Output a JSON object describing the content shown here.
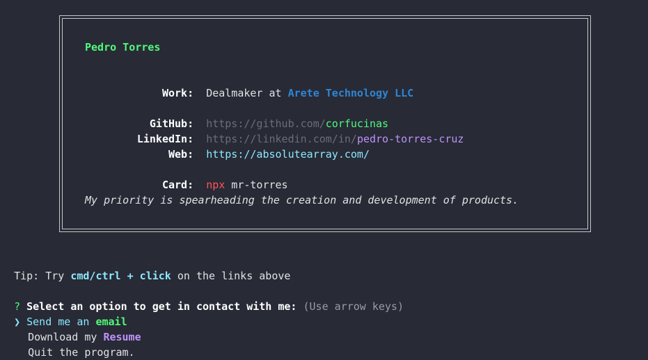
{
  "card": {
    "name": "Pedro Torres",
    "work": {
      "label": "Work:",
      "role": "Dealmaker at ",
      "company": "Arete Technology LLC"
    },
    "github": {
      "label": "GitHub:",
      "prefix": "https://github.com/",
      "handle": "corfucinas"
    },
    "linkedin": {
      "label": "LinkedIn:",
      "prefix": "https://linkedin.com/in/",
      "handle": "pedro-torres-cruz"
    },
    "web": {
      "label": "Web:",
      "url": "https://absolutearray.com/"
    },
    "npx": {
      "label": "Card:",
      "cmd": "npx",
      "pkg": " mr-torres"
    },
    "bio": "My priority is spearheading the creation and development of products."
  },
  "tip": {
    "prefix": "Tip: Try ",
    "keys": "cmd/ctrl + click",
    "suffix": " on the links above"
  },
  "prompt": {
    "mark": "?",
    "question": "Select an option to get in contact with me:",
    "hint": "(Use arrow keys)",
    "pointer": "❯",
    "options": [
      {
        "prefix": "Send me an ",
        "highlight": "email"
      },
      {
        "prefix": "Download my ",
        "highlight": "Resume"
      },
      {
        "prefix": "Quit the program.",
        "highlight": ""
      }
    ]
  }
}
